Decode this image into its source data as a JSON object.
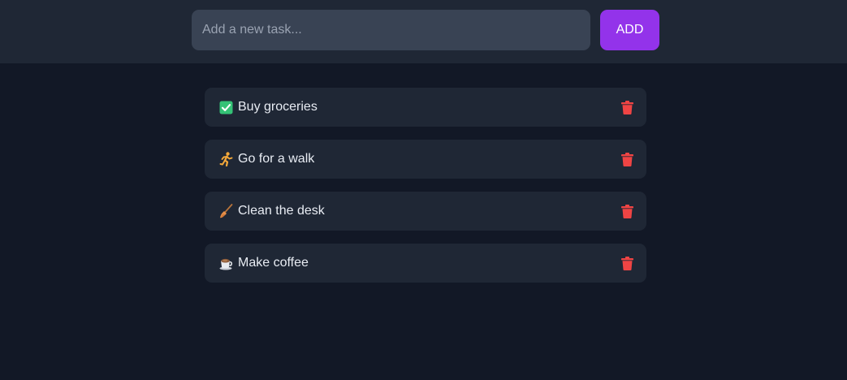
{
  "header": {
    "input": {
      "placeholder": "Add a new task...",
      "value": ""
    },
    "add_label": "ADD"
  },
  "tasks": [
    {
      "label": "Buy groceries",
      "icon": "check-box-icon"
    },
    {
      "label": "Go for a walk",
      "icon": "running-person-icon"
    },
    {
      "label": "Clean the desk",
      "icon": "broom-icon"
    },
    {
      "label": "Make coffee",
      "icon": "coffee-cup-icon"
    }
  ],
  "colors": {
    "background": "#121826",
    "panel": "#1f2735",
    "input": "#394354",
    "accent": "#9333ea",
    "delete": "#ef4444",
    "check": "#34c276"
  }
}
